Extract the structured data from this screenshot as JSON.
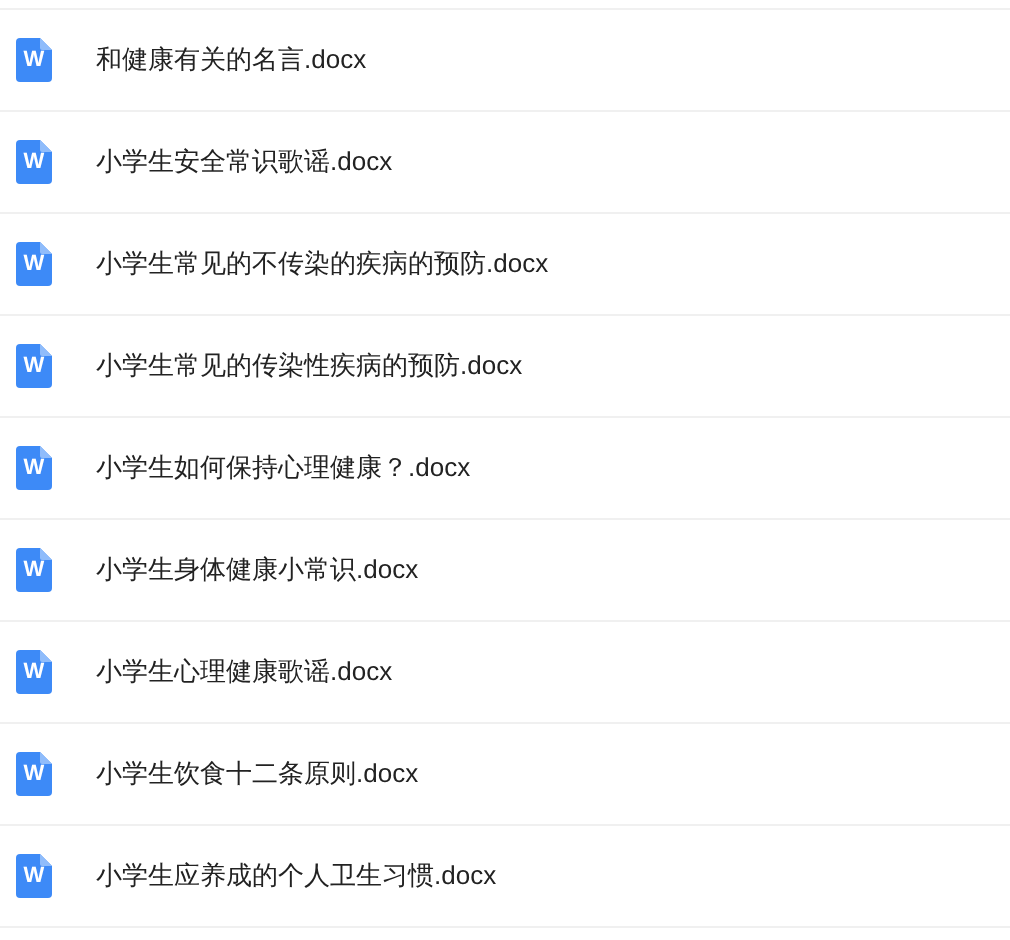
{
  "files": [
    {
      "name": "和健康有关的名言.docx",
      "icon_letter": "W"
    },
    {
      "name": "小学生安全常识歌谣.docx",
      "icon_letter": "W"
    },
    {
      "name": "小学生常见的不传染的疾病的预防.docx",
      "icon_letter": "W"
    },
    {
      "name": "小学生常见的传染性疾病的预防.docx",
      "icon_letter": "W"
    },
    {
      "name": "小学生如何保持心理健康？.docx",
      "icon_letter": "W"
    },
    {
      "name": "小学生身体健康小常识.docx",
      "icon_letter": "W"
    },
    {
      "name": "小学生心理健康歌谣.docx",
      "icon_letter": "W"
    },
    {
      "name": "小学生饮食十二条原则.docx",
      "icon_letter": "W"
    },
    {
      "name": "小学生应养成的个人卫生习惯.docx",
      "icon_letter": "W"
    }
  ]
}
